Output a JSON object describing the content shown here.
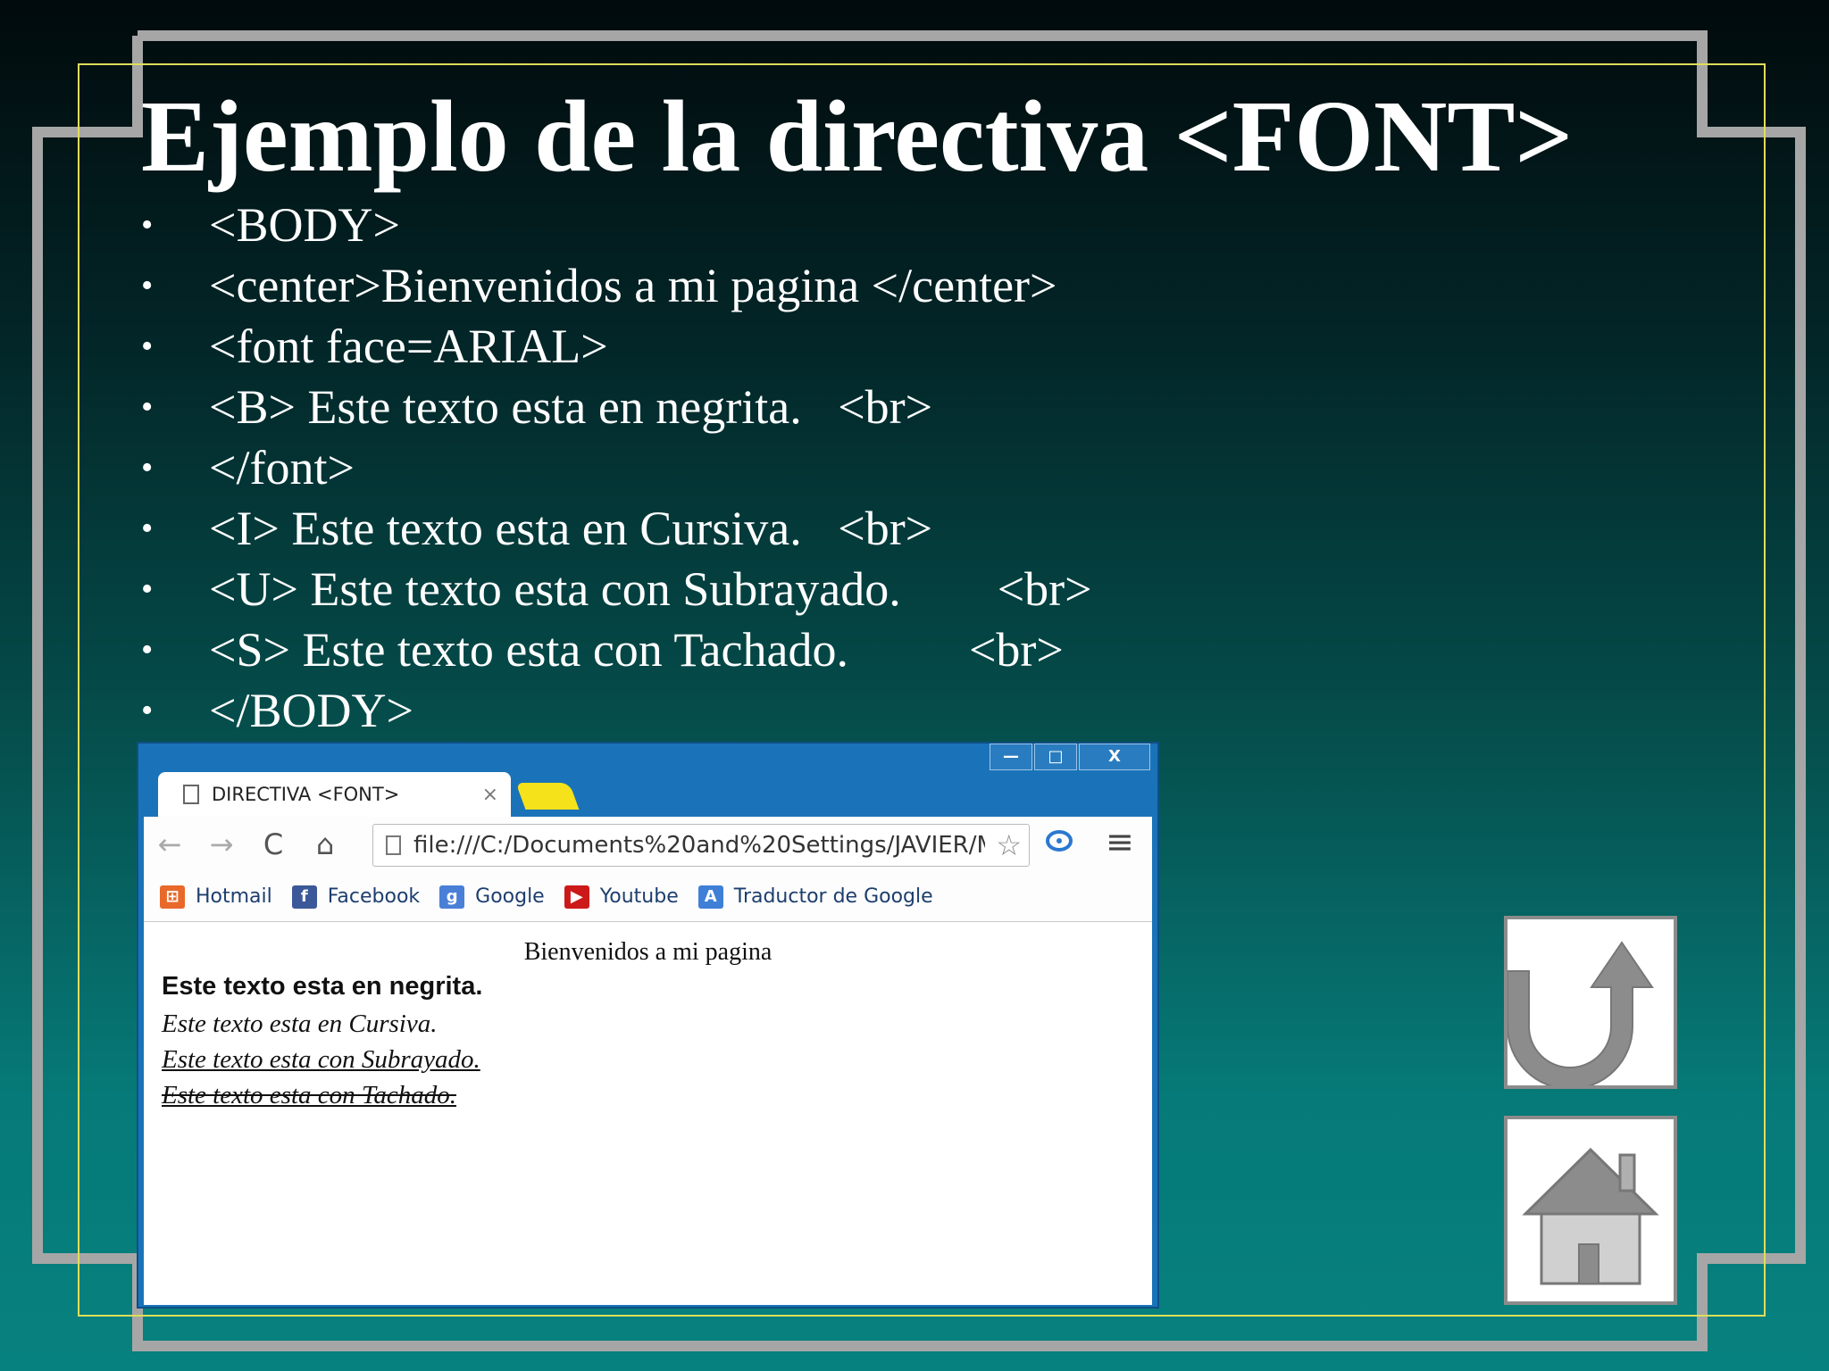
{
  "slide": {
    "title": "Ejemplo de la directiva <FONT>",
    "bullet_symbol": "•",
    "bullets": [
      "<BODY>",
      "<center>Bienvenidos a mi pagina </center>",
      "<font face=ARIAL>",
      "<B> Este texto esta en negrita.   <br>",
      "</font>",
      "<I> Este texto esta en Cursiva.   <br>",
      "<U> Este texto esta con Subrayado.        <br>",
      "<S> Este texto esta con Tachado.          <br>",
      "</BODY>"
    ]
  },
  "browser": {
    "window_controls": {
      "minimize": "—",
      "maximize": "□",
      "close": "X"
    },
    "tab": {
      "title": "DIRECTIVA <FONT>",
      "close": "×"
    },
    "nav": {
      "back": "←",
      "forward": "→",
      "reload": "C",
      "home": "⌂"
    },
    "address": "file:///C:/Documents%20and%20Settings/JAVIER/M",
    "star": "☆",
    "menu": "≡",
    "bookmarks": [
      {
        "label": "Hotmail",
        "icon": "windows-flag-icon",
        "glyph": "⊞",
        "color": "#e8692a"
      },
      {
        "label": "Facebook",
        "icon": "facebook-icon",
        "glyph": "f",
        "color": "#3b5998"
      },
      {
        "label": "Google",
        "icon": "google-icon",
        "glyph": "g",
        "color": "#4a7fd8"
      },
      {
        "label": "Youtube",
        "icon": "youtube-icon",
        "glyph": "▶",
        "color": "#cc1a1a"
      },
      {
        "label": "Traductor de Google",
        "icon": "translate-icon",
        "glyph": "A",
        "color": "#3f7fd6"
      }
    ],
    "page": {
      "center": "Bienvenidos a mi pagina",
      "bold": "Este texto esta en negrita.",
      "italic": "Este texto esta en Cursiva.",
      "underline": "Este texto esta con Subrayado. ",
      "strike": "Este texto esta con Tachado. "
    }
  },
  "colors": {
    "frame": "#a6a6a6",
    "inner_border": "#dede5a",
    "button_icon": "#8c8c8c"
  }
}
